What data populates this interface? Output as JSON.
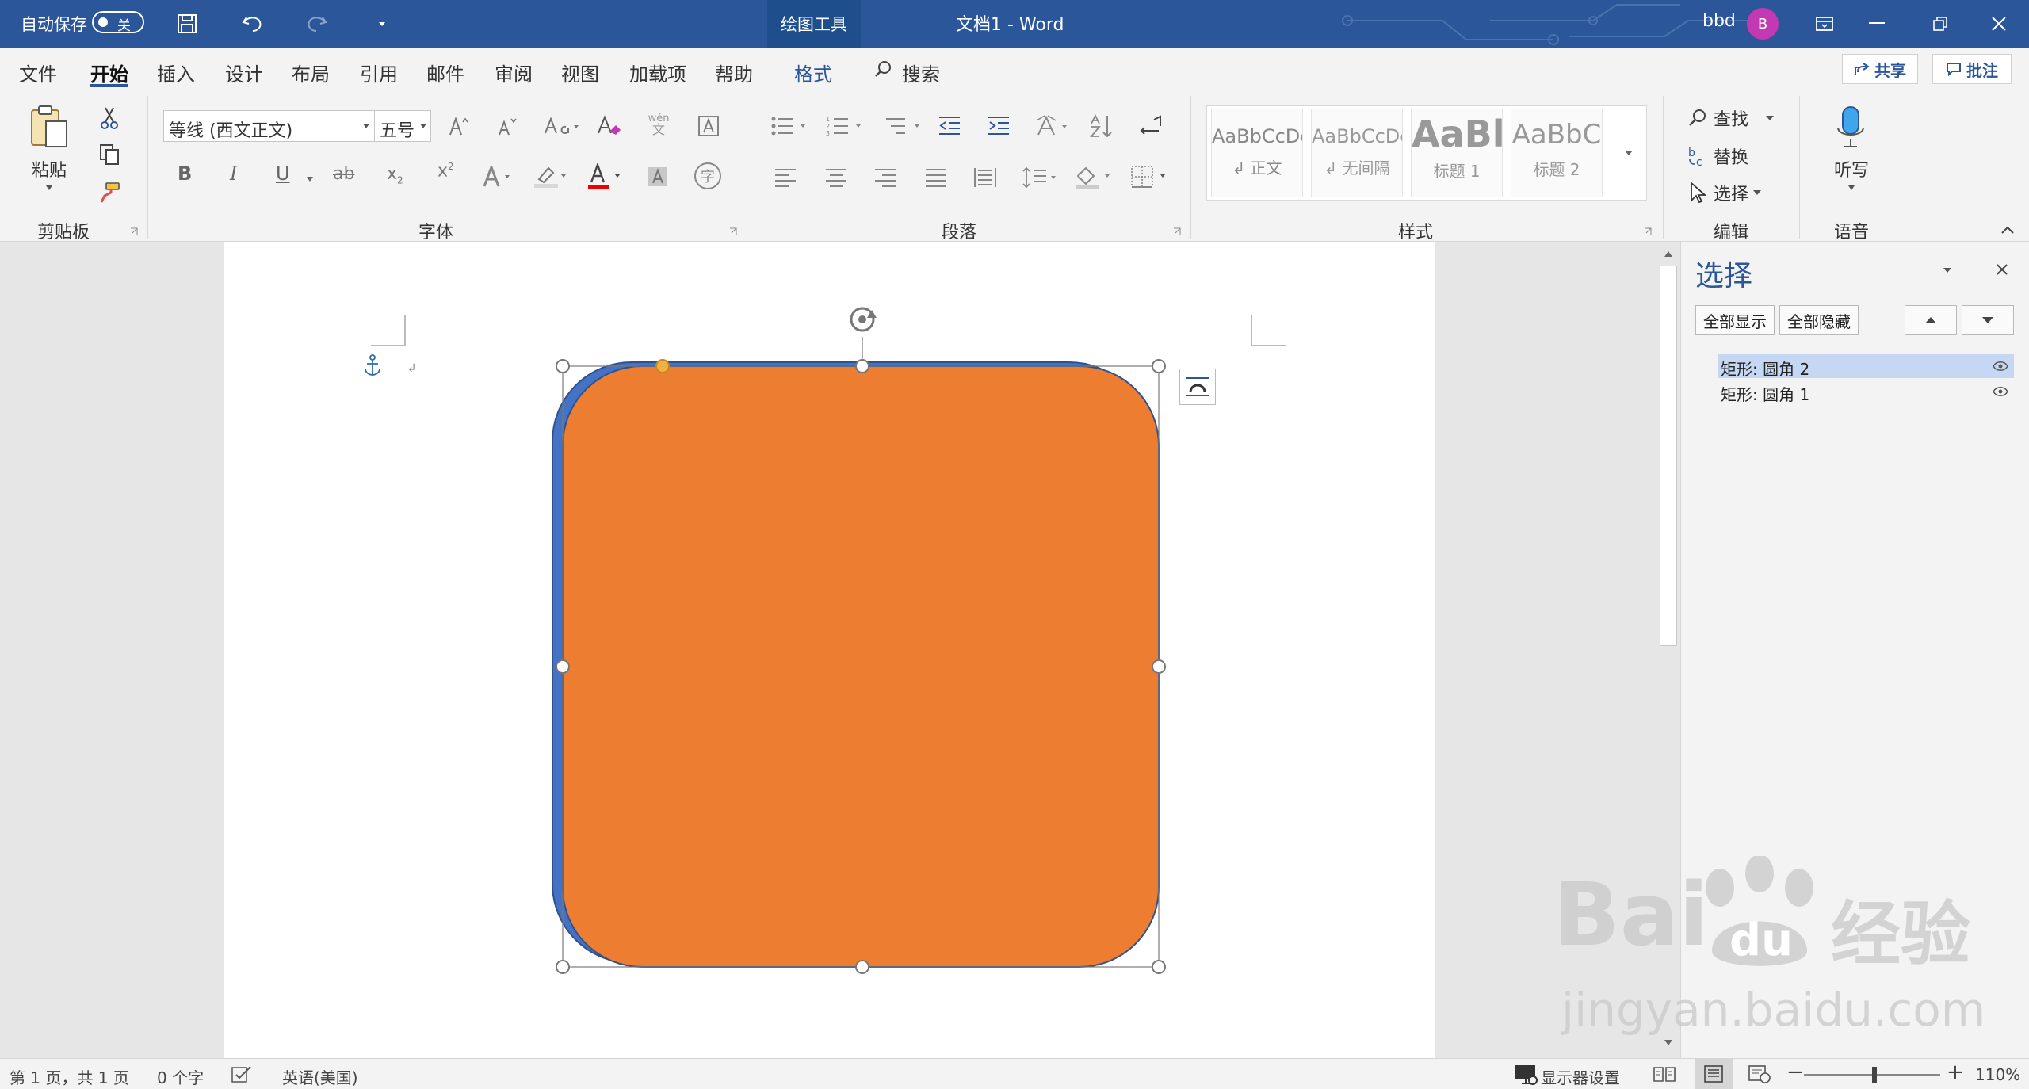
{
  "titlebar": {
    "autosave_label": "自动保存",
    "autosave_toggle": "关",
    "context_tab": "绘图工具",
    "title": "文档1  -  Word",
    "user_name": "bbd",
    "avatar_initial": "B"
  },
  "tabs": [
    "文件",
    "开始",
    "插入",
    "设计",
    "布局",
    "引用",
    "邮件",
    "审阅",
    "视图",
    "加载项",
    "帮助",
    "格式"
  ],
  "search_label": "搜索",
  "share_label": "共享",
  "comments_label": "批注",
  "ribbon": {
    "clipboard": {
      "paste_label": "粘贴",
      "group_label": "剪贴板"
    },
    "font": {
      "font_name": "等线 (西文正文)",
      "font_size": "五号",
      "group_label": "字体",
      "wen_label": "wén",
      "wen_char": "文",
      "circle_char": "字"
    },
    "paragraph": {
      "group_label": "段落"
    },
    "styles": {
      "group_label": "样式",
      "items": [
        {
          "preview": "AaBbCcDc",
          "name": "↲ 正文"
        },
        {
          "preview": "AaBbCcDc",
          "name": "↲ 无间隔"
        },
        {
          "preview": "AaBl",
          "name": "标题 1"
        },
        {
          "preview": "AaBbC",
          "name": "标题 2"
        }
      ]
    },
    "editing": {
      "find_label": "查找",
      "replace_label": "替换",
      "select_label": "选择",
      "group_label": "编辑"
    },
    "voice": {
      "dictate_label": "听写",
      "group_label": "语音"
    }
  },
  "selection_pane": {
    "title": "选择",
    "show_all": "全部显示",
    "hide_all": "全部隐藏",
    "items": [
      {
        "name": "矩形: 圆角 2",
        "selected": true
      },
      {
        "name": "矩形: 圆角 1",
        "selected": false
      }
    ]
  },
  "statusbar": {
    "page_info": "第 1 页，共 1 页",
    "word_count": "0 个字",
    "language": "英语(美国)",
    "display_settings": "显示器设置",
    "zoom": "110%"
  },
  "watermark": {
    "brand": "Bai",
    "paw_text": "du",
    "cn": "经验",
    "url": "jingyan.baidu.com"
  },
  "colors": {
    "title_bg": "#2b579a",
    "shape_front": "#ed7d31",
    "shape_back": "#4472c4",
    "selection_highlight": "#c5d7f2"
  }
}
